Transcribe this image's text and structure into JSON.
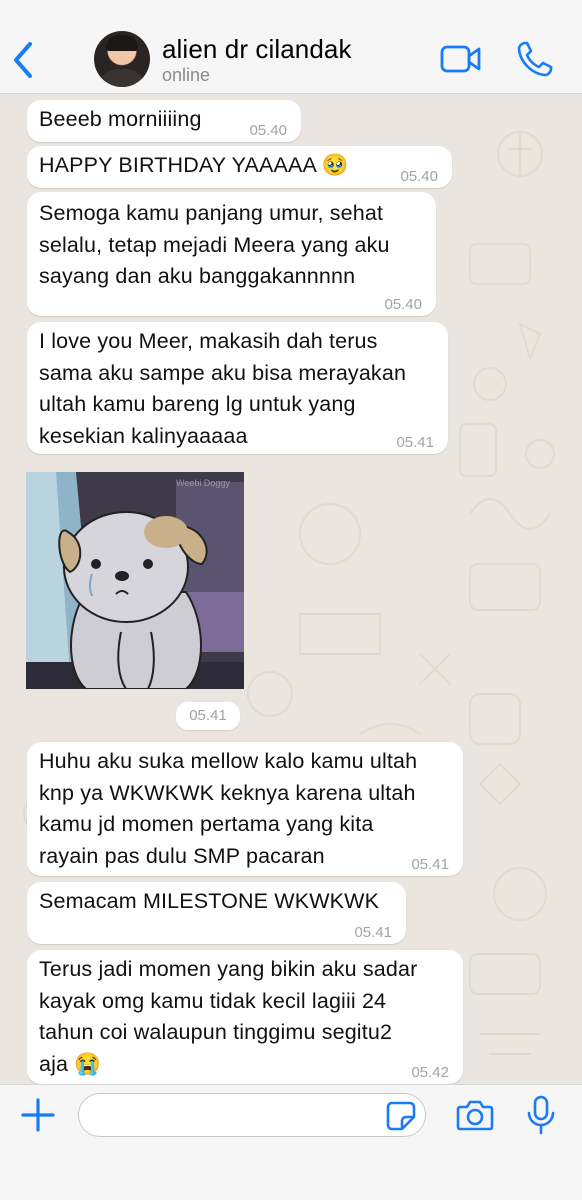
{
  "header": {
    "contact_name": "alien dr cilandak",
    "status": "online",
    "accent": "#1a7cf5"
  },
  "messages": [
    {
      "text": "Beeeb morniiiing",
      "time": "05.40"
    },
    {
      "text": "HAPPY BIRTHDAY YAAAAA 🥹",
      "time": "05.40"
    },
    {
      "text": "Semoga kamu panjang umur, sehat\nselalu, tetap mejadi Meera yang aku\nsayang dan aku banggakannnnn",
      "time": "05.40"
    },
    {
      "text": "I love you Meer, makasih dah terus\nsama aku sampe aku bisa merayakan\nultah kamu bareng lg untuk yang\nkesekian kalinyaaaaa",
      "time": "05.41"
    },
    {
      "text": "Huhu aku suka mellow kalo kamu ultah\nknp ya WKWKWK keknya karena ultah\nkamu jd momen pertama yang kita\nrayain pas dulu SMP pacaran",
      "time": "05.41"
    },
    {
      "text": "Semacam MILESTONE WKWKWK",
      "time": "05.41"
    },
    {
      "text": "Terus jadi momen yang bikin aku sadar\nkayak omg kamu tidak kecil lagiii 24\ntahun coi walaupun tinggimu segitu2\naja 😭",
      "time": "05.42"
    }
  ],
  "sticker": {
    "watermark": "Weebi Doggy",
    "time": "05.41",
    "icon": "sad-puppy-sticker"
  },
  "composer": {
    "value": "",
    "placeholder": ""
  },
  "colors": {
    "incoming_bubble": "#ffffff",
    "chat_background": "#eae6df",
    "bar_background": "#f6f6f6",
    "timestamp": "#a3a3a3"
  }
}
